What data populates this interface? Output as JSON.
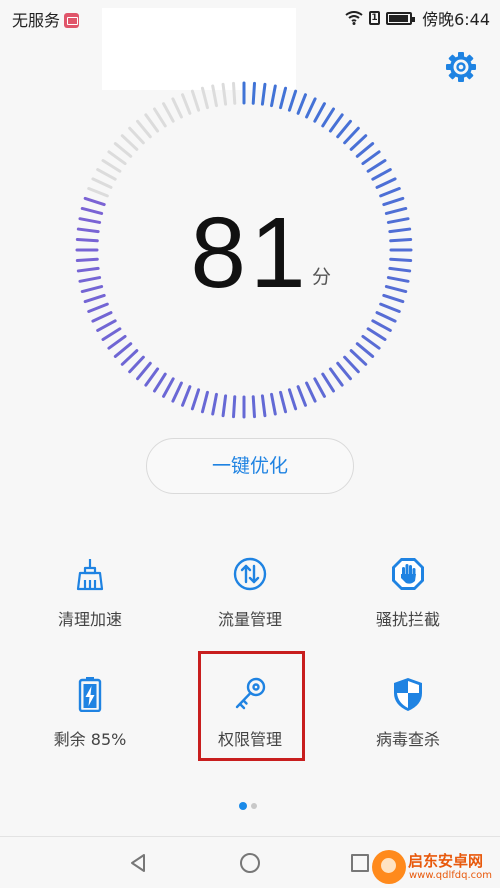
{
  "status": {
    "carrier": "无服务",
    "time": "傍晚6:44",
    "sim_label": "1"
  },
  "score": {
    "value": "81",
    "unit": "分"
  },
  "optimize_button": "一键优化",
  "tools": [
    {
      "label": "清理加速",
      "icon": "broom-icon"
    },
    {
      "label": "流量管理",
      "icon": "data-traffic-icon"
    },
    {
      "label": "骚扰拦截",
      "icon": "block-hand-icon"
    },
    {
      "label": "剩余 85%",
      "icon": "battery-charging-icon"
    },
    {
      "label": "权限管理",
      "icon": "key-icon"
    },
    {
      "label": "病毒查杀",
      "icon": "shield-icon"
    }
  ],
  "pager": {
    "pages": 2,
    "active": 1
  },
  "colors": {
    "accent": "#1f83e2",
    "gauge_blue": "#3f73d6",
    "gauge_purple": "#7b63d4",
    "highlight": "#c81e1e"
  },
  "watermark": {
    "title": "启东安卓网",
    "url": "www.qdlfdq.com"
  }
}
